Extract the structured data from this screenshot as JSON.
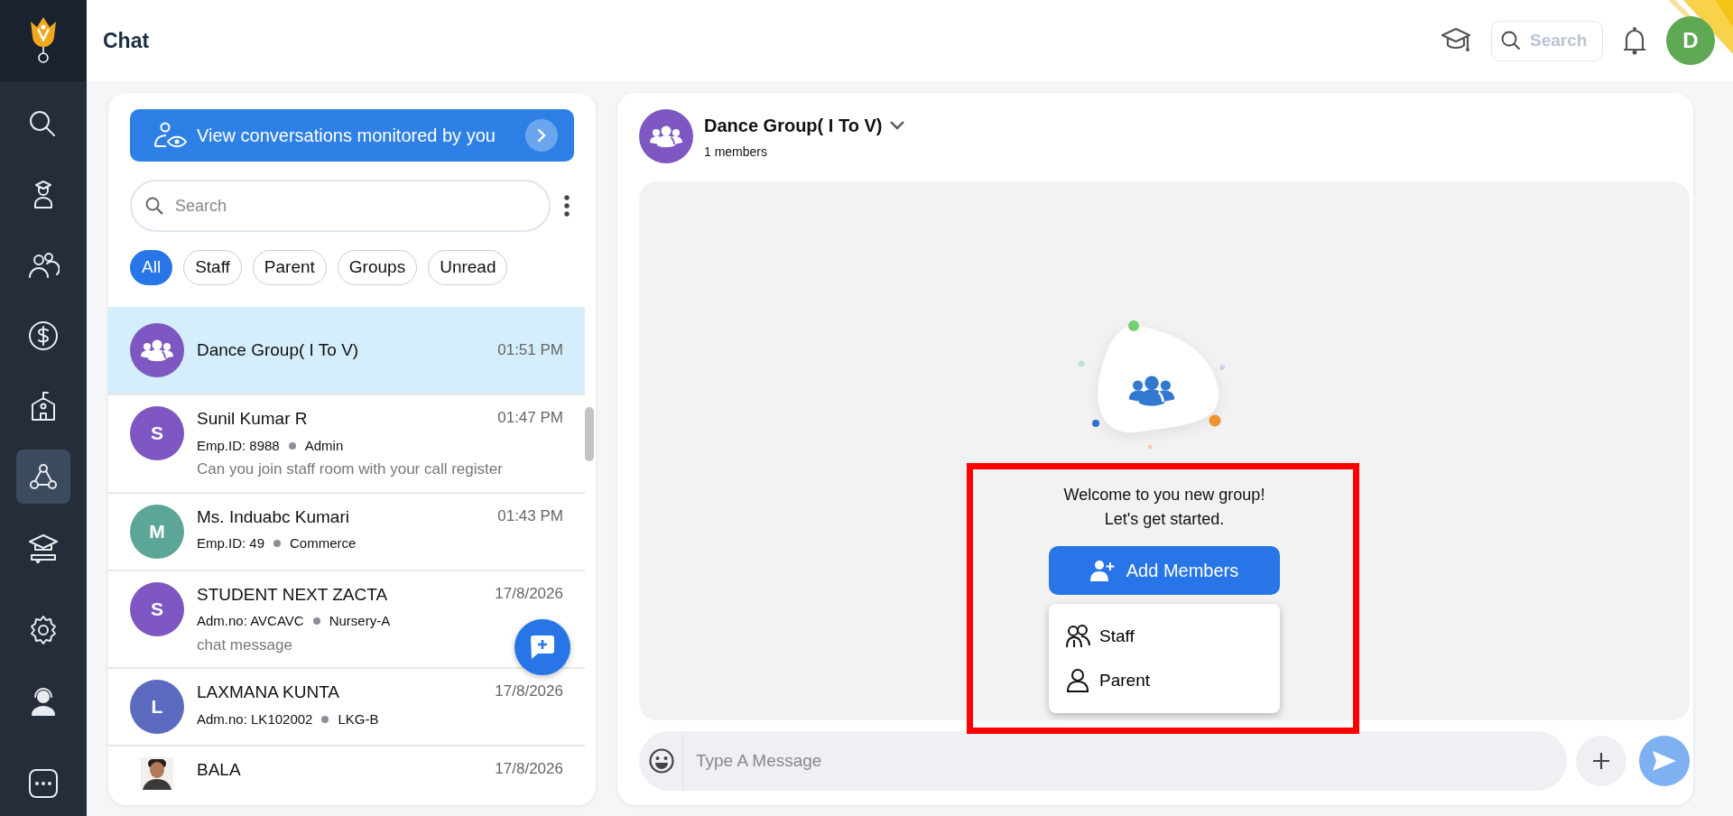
{
  "header": {
    "title": "Chat",
    "search": {
      "placeholder": "Search"
    },
    "avatar": "D"
  },
  "sidebar": {
    "items": [
      {
        "selected": false
      },
      {
        "selected": false
      },
      {
        "selected": false
      },
      {
        "selected": false
      },
      {
        "selected": false
      },
      {
        "selected": true
      },
      {
        "selected": false
      },
      {
        "selected": false
      },
      {
        "selected": false
      },
      {
        "selected": false
      }
    ]
  },
  "monitor_banner": {
    "label": "View conversations monitored by you"
  },
  "list_search": {
    "placeholder": "Search"
  },
  "filters": [
    {
      "label": "All",
      "selected": true
    },
    {
      "label": "Staff",
      "selected": false
    },
    {
      "label": "Parent",
      "selected": false
    },
    {
      "label": "Groups",
      "selected": false
    },
    {
      "label": "Unread",
      "selected": false
    }
  ],
  "conversations": [
    {
      "kind": "group",
      "name": "Dance Group( I To V)",
      "time": "01:51 PM",
      "selected": true,
      "color": "#7e57c2"
    },
    {
      "kind": "letter",
      "initial": "S",
      "name": "Sunil Kumar R",
      "time": "01:47 PM",
      "selected": false,
      "color": "#7e57c2",
      "id": "Emp.ID: 8988",
      "role": "Admin",
      "message": "Can you join staff room with your call register"
    },
    {
      "kind": "letter",
      "initial": "M",
      "name": "Ms. Induabc Kumari",
      "time": "01:43 PM",
      "selected": false,
      "color": "#5ba697",
      "id": "Emp.ID: 49",
      "role": "Commerce"
    },
    {
      "kind": "letter",
      "initial": "S",
      "name": "STUDENT NEXT ZACTA",
      "time": "17/8/2026",
      "selected": false,
      "color": "#7e57c2",
      "id": "Adm.no: AVCAVC",
      "role": "Nursery-A",
      "message": "chat message"
    },
    {
      "kind": "letter",
      "initial": "L",
      "name": "LAXMANA KUNTA",
      "time": "17/8/2026",
      "selected": false,
      "color": "#5c6bc0",
      "id": "Adm.no: LK102002",
      "role": "LKG-B"
    },
    {
      "kind": "picture",
      "name": "BALA",
      "time": "17/8/2026",
      "selected": false
    }
  ],
  "chat": {
    "title": "Dance Group( I To V)",
    "members": "1 members",
    "welcome": [
      "Welcome to you new group!",
      "Let's get started."
    ],
    "add_button": "Add Members",
    "menu": [
      {
        "kind": "staff",
        "label": "Staff"
      },
      {
        "kind": "parent",
        "label": "Parent"
      }
    ],
    "composer": {
      "placeholder": "Type A Message"
    }
  }
}
